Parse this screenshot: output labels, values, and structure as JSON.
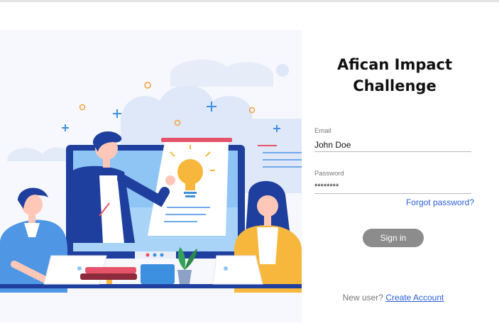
{
  "app": {
    "title_line1": "Afican Impact",
    "title_line2": "Challenge"
  },
  "form": {
    "email_label": "Email",
    "email_value": "John Doe",
    "password_label": "Password",
    "password_value": "********",
    "forgot_password": "Forgot password?",
    "sign_in": "Sign in",
    "new_user_prompt": "New user?",
    "create_account": "Create Account"
  },
  "colors": {
    "accent_link": "#2b5fd9",
    "button_disabled": "#8c8c8c",
    "illustration_blue": "#1f3f9e",
    "illustration_yellow": "#f6b73c"
  },
  "illustration": {
    "icon": "team-presentation-illustration"
  }
}
